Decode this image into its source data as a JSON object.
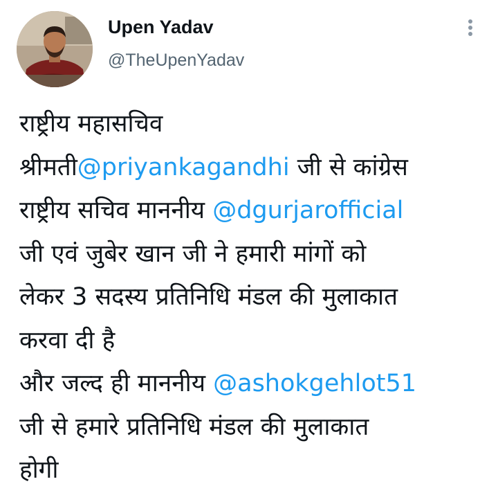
{
  "user": {
    "display_name": "Upen Yadav",
    "handle": "@TheUpenYadav",
    "avatar_icon": "profile-photo"
  },
  "menu": {
    "icon": "more-vertical-icon"
  },
  "tweet": {
    "lines": [
      {
        "text": "राष्ट्रीय महासचिव"
      },
      {
        "before": "श्रीमती",
        "mention": "@priyankagandhi",
        "after": " जी से कांग्रेस"
      },
      {
        "before": "राष्ट्रीय सचिव माननीय ",
        "mention": "@dgurjarofficial",
        "after": ""
      },
      {
        "text": "जी एवं जुबेर खान जी ने हमारी मांगों को"
      },
      {
        "text": "लेकर 3 सदस्य प्रतिनिधि मंडल की मुलाकात"
      },
      {
        "text": "करवा दी है"
      },
      {
        "before": "और जल्द ही माननीय ",
        "mention": "@ashokgehlot51",
        "after": ""
      },
      {
        "text": "जी से हमारे प्रतिनिधि मंडल की मुलाकात"
      },
      {
        "text": "होगी"
      }
    ]
  },
  "colors": {
    "text": "#0f1419",
    "secondary": "#536471",
    "mention": "#1d9bf0",
    "background": "#ffffff"
  }
}
